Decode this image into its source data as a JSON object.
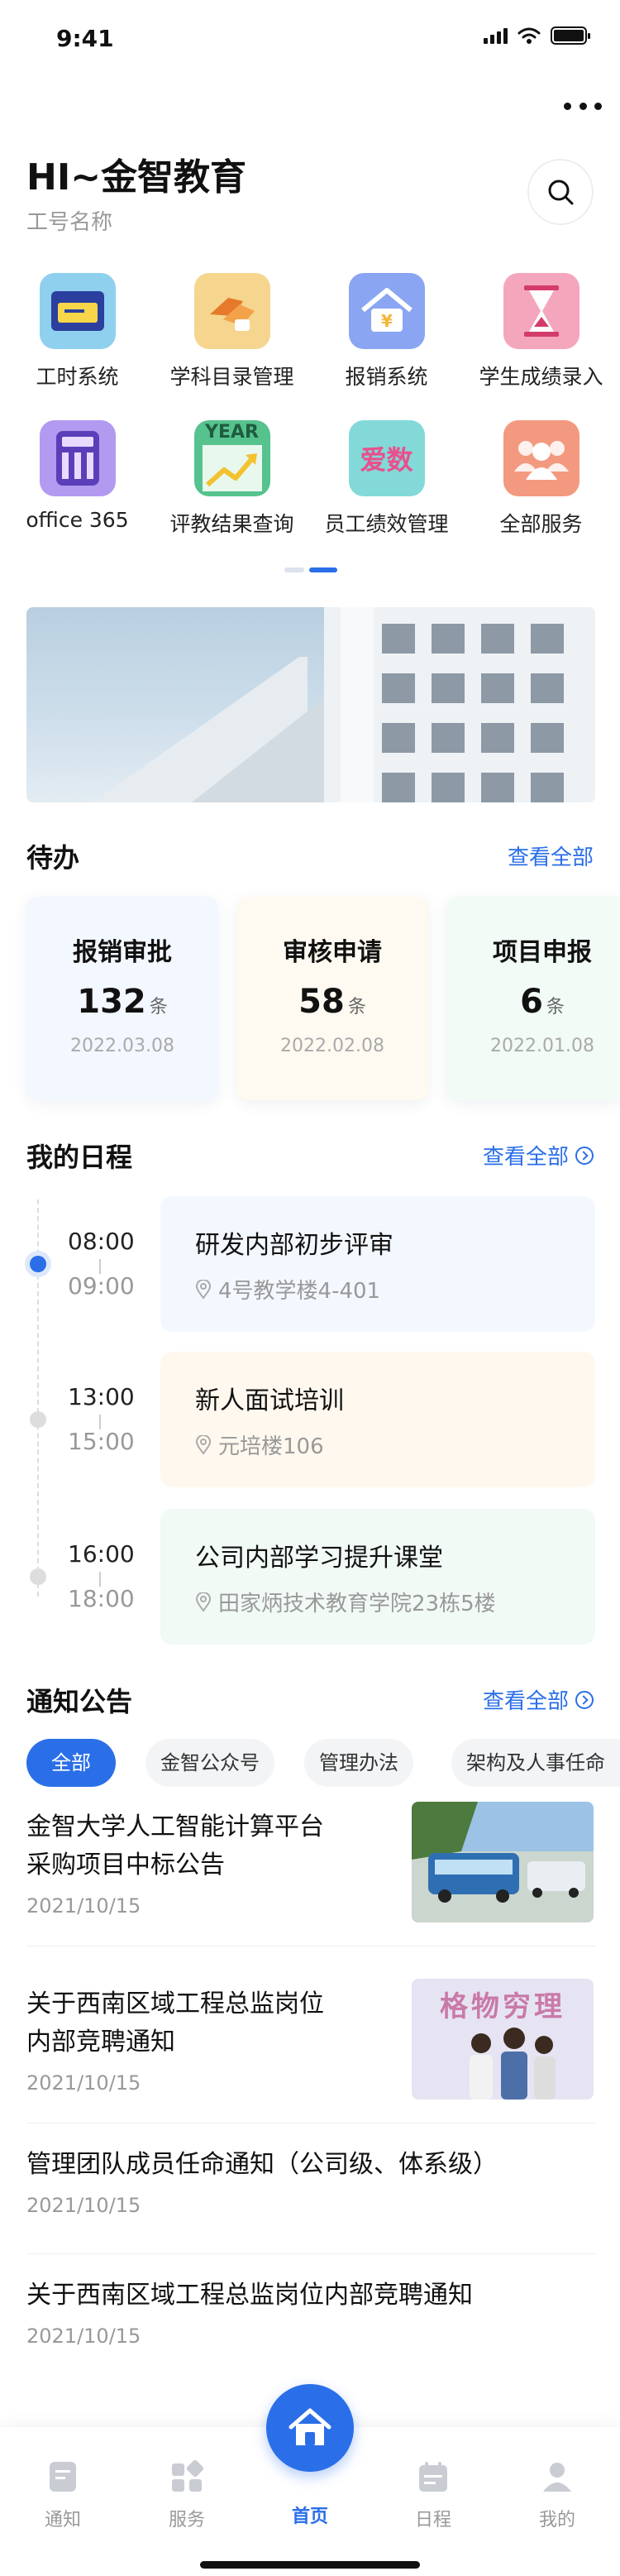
{
  "status_bar": {
    "time": "9:41"
  },
  "header": {
    "greeting": "HI~金智教育",
    "subtitle": "工号名称"
  },
  "apps": [
    {
      "label": "工时系统",
      "icon": "timesheet-icon",
      "color": "#8fd0ef"
    },
    {
      "label": "学科目录管理",
      "icon": "handshake-icon",
      "color": "#f6d58f"
    },
    {
      "label": "报销系统",
      "icon": "yuan-house-icon",
      "color": "#8aa6f2"
    },
    {
      "label": "学生成绩录入",
      "icon": "hourglass-icon",
      "color": "#f4a6bd"
    },
    {
      "label": "office 365",
      "icon": "calculator-icon",
      "color": "#b39af1"
    },
    {
      "label": "评教结果查询",
      "icon": "year-chart-icon",
      "color": "#56c38e"
    },
    {
      "label": "员工绩效管理",
      "icon": "aishu-icon",
      "color": "#83d8d8"
    },
    {
      "label": "全部服务",
      "icon": "all-services-icon",
      "color": "#f3997f"
    }
  ],
  "app_icon_text": {
    "year": "YEAR",
    "aishu": "爱数"
  },
  "todo": {
    "title": "待办",
    "link": "查看全部",
    "cards": [
      {
        "title": "报销审批",
        "count": "132",
        "unit": "条",
        "date": "2022.03.08",
        "bg": "#f3f7ff"
      },
      {
        "title": "审核申请",
        "count": "58",
        "unit": "条",
        "date": "2022.02.08",
        "bg": "#fffaf1"
      },
      {
        "title": "项目申报",
        "count": "6",
        "unit": "条",
        "date": "2022.01.08",
        "bg": "#f3fbf6"
      }
    ]
  },
  "schedule": {
    "title": "我的日程",
    "link": "查看全部",
    "items": [
      {
        "start": "08:00",
        "end": "09:00",
        "title": "研发内部初步评审",
        "location": "4号教学楼4-401",
        "bg": "#f3f7fe",
        "active": true
      },
      {
        "start": "13:00",
        "end": "15:00",
        "title": "新人面试培训",
        "location": "元培楼106",
        "bg": "#fff8ef",
        "active": false
      },
      {
        "start": "16:00",
        "end": "18:00",
        "title": "公司内部学习提升课堂",
        "location": "田家炳技术教育学院23栋5楼",
        "bg": "#f2faf6",
        "active": false
      }
    ]
  },
  "notices": {
    "title": "通知公告",
    "link": "查看全部",
    "tabs": [
      {
        "label": "全部",
        "active": true
      },
      {
        "label": "金智公众号",
        "active": false
      },
      {
        "label": "管理办法",
        "active": false
      },
      {
        "label": "架构及人事任命",
        "active": false
      }
    ],
    "items": [
      {
        "title_line1": "金智大学人工智能计算平台",
        "title_line2": "采购项目中标公告",
        "date": "2021/10/15",
        "has_image": true
      },
      {
        "title_line1": "关于西南区域工程总监岗位",
        "title_line2": "内部竞聘通知",
        "date": "2021/10/15",
        "has_image": true
      },
      {
        "title_line1": "管理团队成员任命通知（公司级、体系级）",
        "title_line2": "",
        "date": "2021/10/15",
        "has_image": false
      },
      {
        "title_line1": "关于西南区域工程总监岗位内部竞聘通知",
        "title_line2": "",
        "date": "2021/10/15",
        "has_image": false
      }
    ],
    "image_text": "格物穷理"
  },
  "tabbar": {
    "tabs": [
      {
        "label": "通知",
        "icon": "notice-doc-icon",
        "active": false
      },
      {
        "label": "服务",
        "icon": "service-grid-icon",
        "active": false
      },
      {
        "label": "首页",
        "icon": "home-icon",
        "active": true
      },
      {
        "label": "日程",
        "icon": "calendar-icon",
        "active": false
      },
      {
        "label": "我的",
        "icon": "profile-icon",
        "active": false
      }
    ]
  },
  "colors": {
    "accent": "#2a6ee8",
    "text": "#111111",
    "muted": "#999999"
  }
}
